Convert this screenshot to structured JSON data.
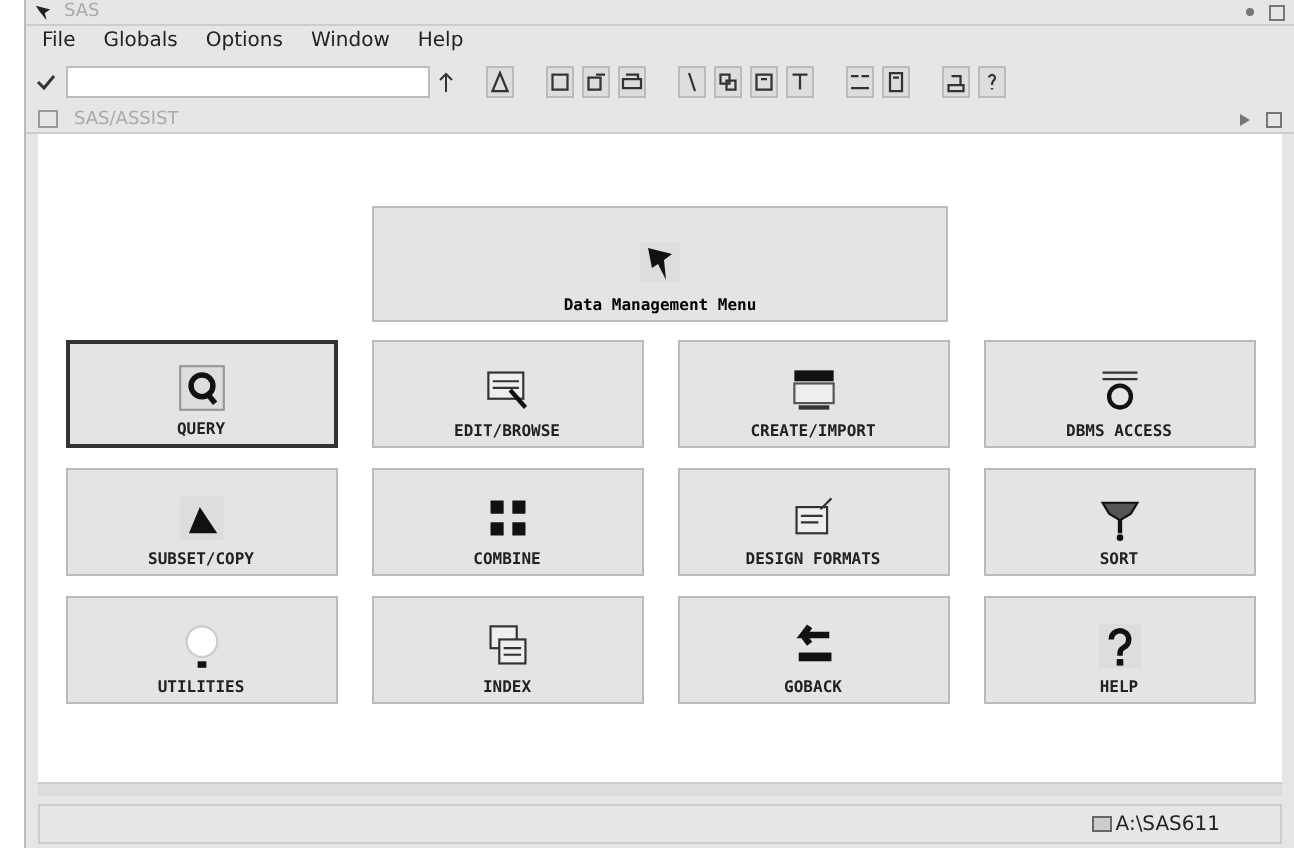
{
  "window": {
    "title": "SAS"
  },
  "menu": [
    "File",
    "Globals",
    "Options",
    "Window",
    "Help"
  ],
  "inner_window": {
    "title": "SAS/ASSIST"
  },
  "header_button": {
    "label": "Data Management Menu"
  },
  "tiles": [
    {
      "label": "QUERY",
      "selected": true
    },
    {
      "label": "EDIT/BROWSE",
      "selected": false
    },
    {
      "label": "CREATE/IMPORT",
      "selected": false
    },
    {
      "label": "DBMS ACCESS",
      "selected": false
    },
    {
      "label": "SUBSET/COPY",
      "selected": false
    },
    {
      "label": "COMBINE",
      "selected": false
    },
    {
      "label": "DESIGN FORMATS",
      "selected": false
    },
    {
      "label": "SORT",
      "selected": false
    },
    {
      "label": "UTILITIES",
      "selected": false
    },
    {
      "label": "INDEX",
      "selected": false
    },
    {
      "label": "GOBACK",
      "selected": false
    },
    {
      "label": "HELP",
      "selected": false
    }
  ],
  "status_bar": {
    "path": "A:\\SAS611"
  }
}
